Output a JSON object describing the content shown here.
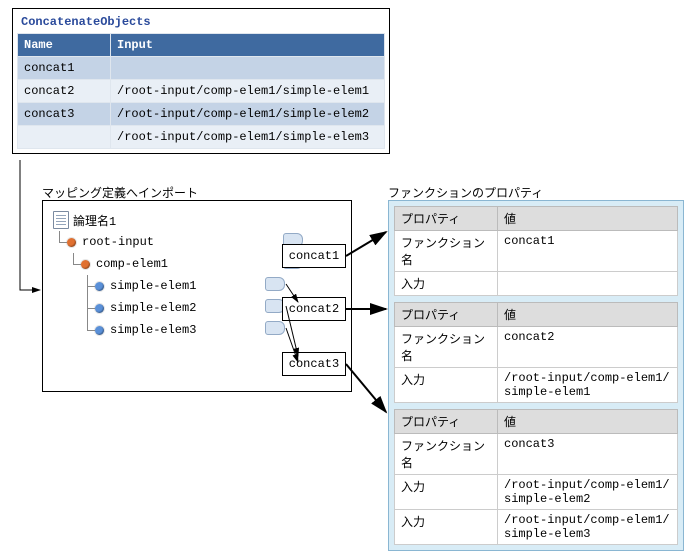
{
  "concat_objects": {
    "title": "ConcatenateObjects",
    "cols": {
      "name": "Name",
      "input": "Input"
    },
    "rows": [
      {
        "name": "concat1",
        "input": ""
      },
      {
        "name": "concat2",
        "input": "/root-input/comp-elem1/simple-elem1"
      },
      {
        "name": "concat3",
        "input": "/root-input/comp-elem1/simple-elem2"
      },
      {
        "name": "",
        "input": "/root-input/comp-elem1/simple-elem3"
      }
    ]
  },
  "import": {
    "label": "マッピング定義へインポート",
    "root_label": "論理名1",
    "tree": {
      "root_input": "root-input",
      "comp_elem1": "comp-elem1",
      "simple_elem1": "simple-elem1",
      "simple_elem2": "simple-elem2",
      "simple_elem3": "simple-elem3"
    }
  },
  "concat_nodes": {
    "c1": "concat1",
    "c2": "concat2",
    "c3": "concat3"
  },
  "props": {
    "label": "ファンクションのプロパティ",
    "headers": {
      "prop": "プロパティ",
      "val": "値"
    },
    "rowlabels": {
      "func": "ファンクション名",
      "input": "入力"
    },
    "tables": [
      {
        "func": "concat1",
        "inputs": [
          ""
        ]
      },
      {
        "func": "concat2",
        "inputs": [
          "/root-input/comp-elem1/simple-elem1"
        ]
      },
      {
        "func": "concat3",
        "inputs": [
          "/root-input/comp-elem1/simple-elem2",
          "/root-input/comp-elem1/simple-elem3"
        ]
      }
    ]
  }
}
